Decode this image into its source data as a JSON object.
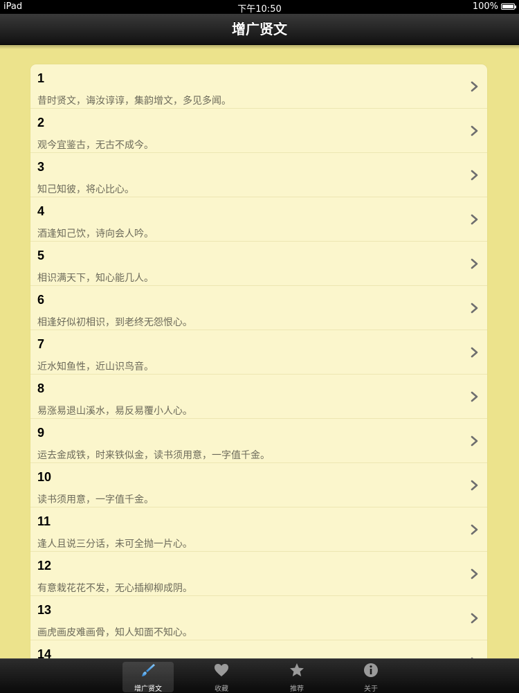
{
  "status": {
    "carrier": "iPad",
    "time": "下午10:50",
    "battery": "100%"
  },
  "nav": {
    "title": "增广贤文"
  },
  "rows": [
    {
      "num": "1",
      "text": "昔时贤文，诲汝谆谆，集韵增文，多见多闻。"
    },
    {
      "num": "2",
      "text": "观今宜鉴古，无古不成今。"
    },
    {
      "num": "3",
      "text": "知己知彼，将心比心。"
    },
    {
      "num": "4",
      "text": "酒逢知己饮，诗向会人吟。"
    },
    {
      "num": "5",
      "text": "相识满天下，知心能几人。"
    },
    {
      "num": "6",
      "text": "相逢好似初相识，到老终无怨恨心。"
    },
    {
      "num": "7",
      "text": "近水知鱼性，近山识鸟音。"
    },
    {
      "num": "8",
      "text": "易涨易退山溪水，易反易覆小人心。"
    },
    {
      "num": "9",
      "text": "运去金成铁，时来铁似金，读书须用意，一字值千金。"
    },
    {
      "num": "10",
      "text": "读书须用意，一字值千金。"
    },
    {
      "num": "11",
      "text": "逢人且说三分话，未可全抛一片心。"
    },
    {
      "num": "12",
      "text": "有意栽花花不发，无心插柳柳成阴。"
    },
    {
      "num": "13",
      "text": "画虎画皮难画骨，知人知面不知心。"
    },
    {
      "num": "14",
      "text": ""
    }
  ],
  "tabs": [
    {
      "label": "增广贤文",
      "icon": "brush-icon",
      "active": true
    },
    {
      "label": "收藏",
      "icon": "heart-icon"
    },
    {
      "label": "推荐",
      "icon": "star-icon"
    },
    {
      "label": "关于",
      "icon": "info-icon"
    }
  ],
  "colors": {
    "background": "#ece38c",
    "list_background": "#fbf6cc",
    "text_gray": "#6c6a5a"
  }
}
